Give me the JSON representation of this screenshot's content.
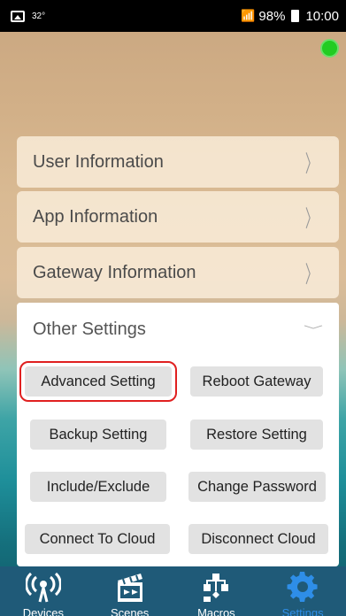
{
  "statusbar": {
    "temperature": "32°",
    "battery_text": "98%",
    "time": "10:00"
  },
  "colors": {
    "online_indicator": "#22cc22",
    "highlight_border": "#e02020",
    "tabbar_background": "#1f5a78",
    "active_tab": "#2e8ee8"
  },
  "menu": {
    "user_info": "User Information",
    "app_info": "App Information",
    "gateway_info": "Gateway Information",
    "chevron": "〉"
  },
  "other_settings": {
    "title": "Other Settings",
    "chevron": "﹀",
    "buttons": {
      "advanced": "Advanced Setting",
      "reboot": "Reboot Gateway",
      "backup": "Backup Setting",
      "restore": "Restore Setting",
      "include_exclude": "Include/Exclude",
      "change_password": "Change Password",
      "connect_cloud": "Connect To Cloud",
      "disconnect_cloud": "Disconnect Cloud"
    }
  },
  "tabs": {
    "devices": "Devices",
    "scenes": "Scenes",
    "macros": "Macros",
    "settings": "Settings",
    "active": "settings"
  }
}
